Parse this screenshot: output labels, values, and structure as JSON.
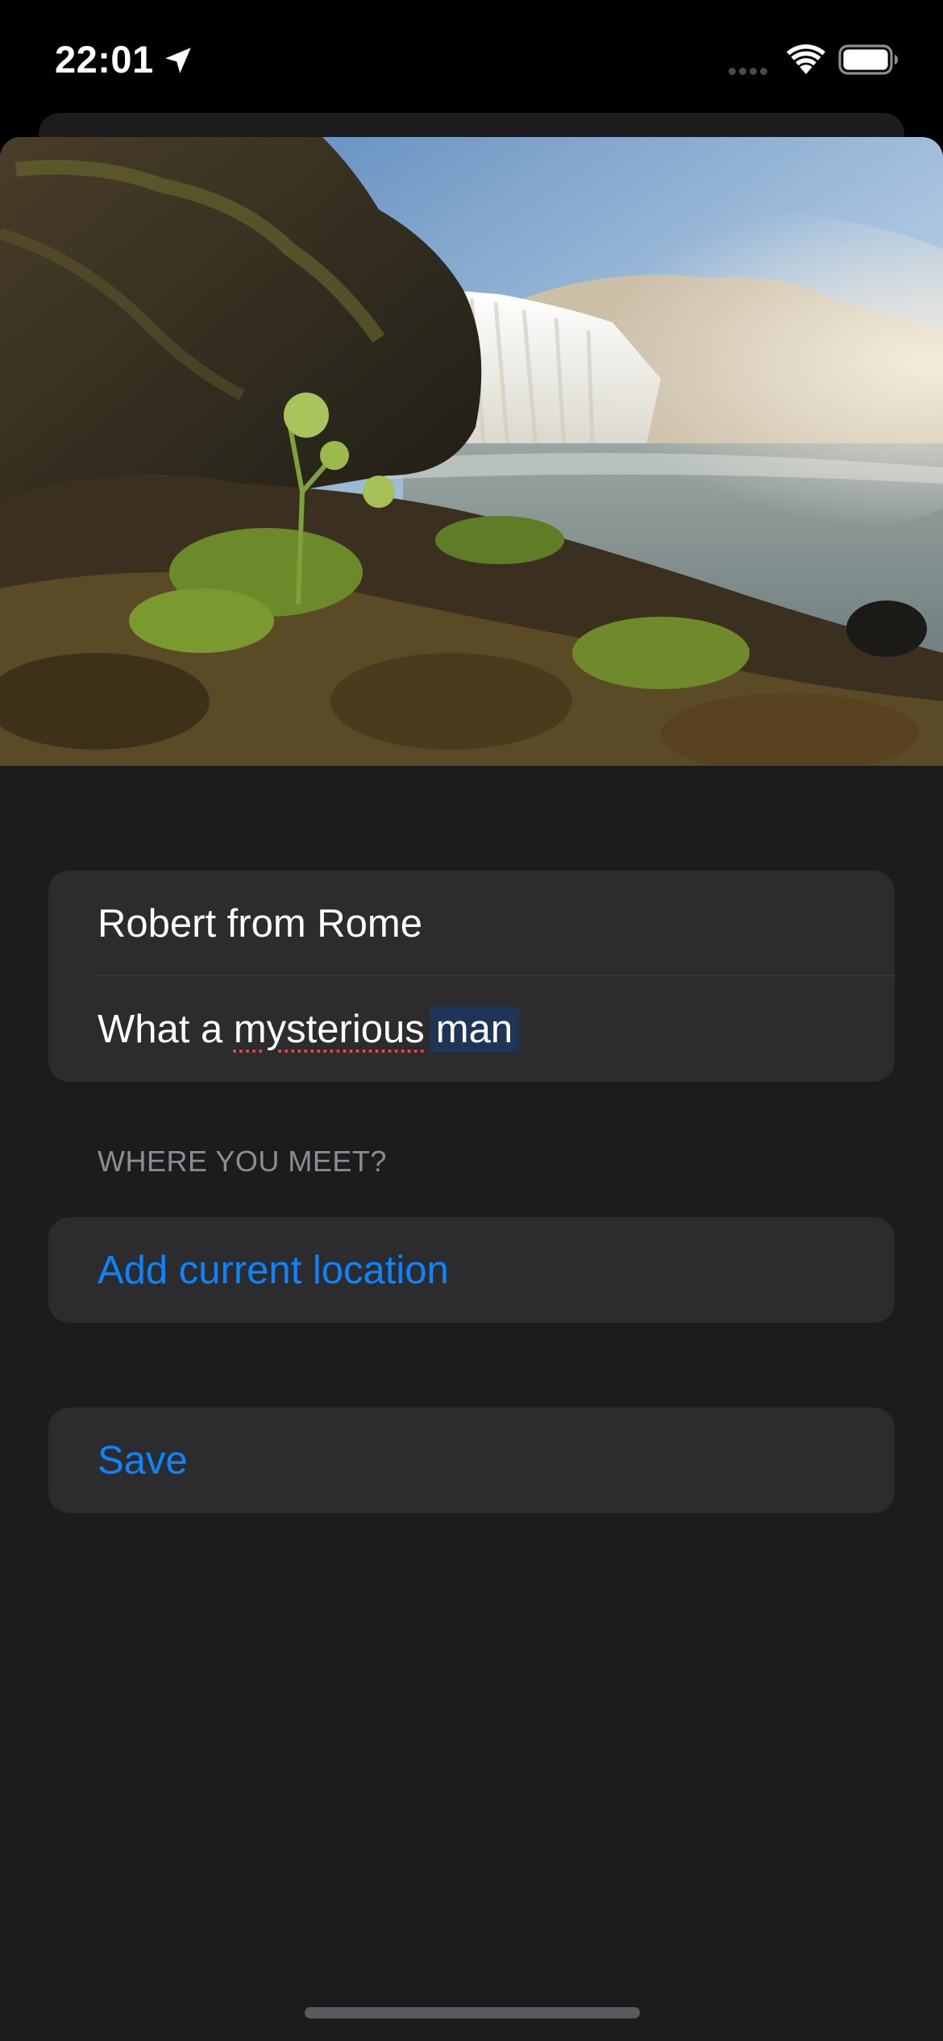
{
  "status_bar": {
    "time": "22:01",
    "icons": [
      "location-arrow-icon",
      "cellular-signal-icon",
      "wifi-icon",
      "battery-icon"
    ]
  },
  "colors": {
    "background": "#1c1c1e",
    "group_background": "#2c2c2e",
    "accent": "#0a84ff",
    "secondary_text": "#8d8d93",
    "spell_error": "#ff453a",
    "selection": "#1d3658"
  },
  "form": {
    "name_value": "Robert from Rome",
    "note": {
      "lead": "What a ",
      "misspelled": "mysterious",
      "selected": "man"
    },
    "location_section_header": "WHERE YOU MEET?",
    "add_location_label": "Add current location",
    "save_label": "Save"
  }
}
